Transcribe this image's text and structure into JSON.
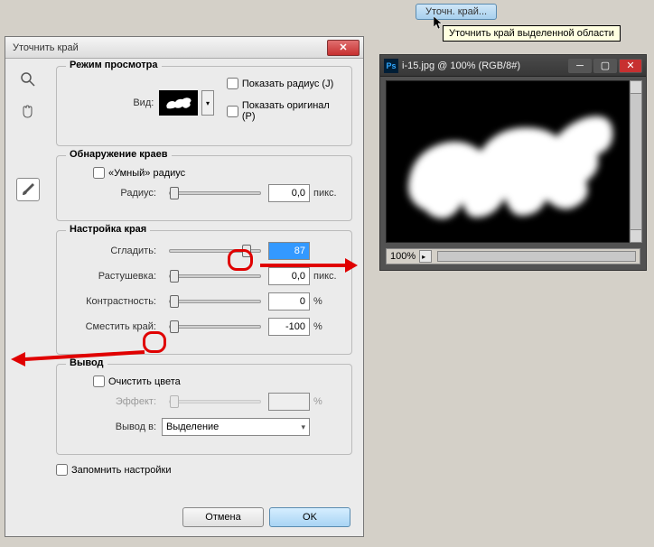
{
  "topButton": {
    "label": "Уточн. край..."
  },
  "tooltip": "Уточнить край выделенной области",
  "dialog": {
    "title": "Уточнить край",
    "viewMode": {
      "groupTitle": "Режим просмотра",
      "viewLabel": "Вид:",
      "showRadius": "Показать радиус (J)",
      "showOriginal": "Показать оригинал (P)"
    },
    "edgeDetect": {
      "groupTitle": "Обнаружение краев",
      "smartRadius": "«Умный» радиус",
      "radiusLabel": "Радиус:",
      "radiusValue": "0,0",
      "unit": "пикс."
    },
    "adjust": {
      "groupTitle": "Настройка края",
      "smoothLabel": "Сгладить:",
      "smoothValue": "87",
      "featherLabel": "Растушевка:",
      "featherValue": "0,0",
      "featherUnit": "пикс.",
      "contrastLabel": "Контрастность:",
      "contrastValue": "0",
      "contrastUnit": "%",
      "shiftLabel": "Сместить край:",
      "shiftValue": "-100",
      "shiftUnit": "%"
    },
    "output": {
      "groupTitle": "Вывод",
      "decontaminate": "Очистить цвета",
      "amountLabel": "Эффект:",
      "amountValue": "",
      "amountUnit": "%",
      "outputToLabel": "Вывод в:",
      "outputToValue": "Выделение"
    },
    "remember": "Запомнить настройки",
    "cancel": "Отмена",
    "ok": "OK"
  },
  "imageWindow": {
    "title": "i-15.jpg @ 100% (RGB/8#)",
    "zoom": "100%"
  }
}
